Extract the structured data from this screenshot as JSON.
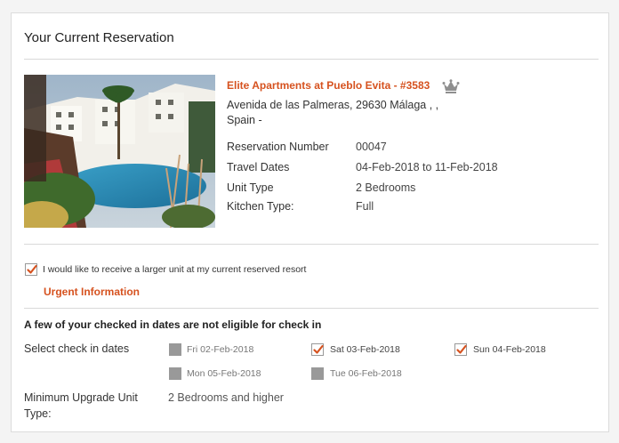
{
  "panel": {
    "title": "Your Current Reservation"
  },
  "resort": {
    "image_alt": "resort-photo",
    "name": "Elite Apartments at Pueblo Evita - #3583",
    "address_line1": "Avenida de las Palmeras, 29630 Málaga ,  ,",
    "address_line2": "Spain  -",
    "crown_icon": "crown-icon"
  },
  "details": [
    {
      "label": "Reservation Number",
      "value": "00047"
    },
    {
      "label": "Travel Dates",
      "value": "04-Feb-2018 to 11-Feb-2018"
    },
    {
      "label": "Unit Type",
      "value": "2 Bedrooms"
    },
    {
      "label": "Kitchen Type:",
      "value": "Full"
    }
  ],
  "upgrade": {
    "checked": true,
    "label": "I would like to receive a larger unit at my current reserved resort",
    "urgent_link": "Urgent Information"
  },
  "checkin": {
    "warning": "A few of your checked in dates are not eligible for check in",
    "select_label": "Select check in dates",
    "dates": [
      {
        "label": "Fri 02-Feb-2018",
        "state": "disabled"
      },
      {
        "label": "Sat 03-Feb-2018",
        "state": "checked"
      },
      {
        "label": "Sun 04-Feb-2018",
        "state": "checked"
      },
      {
        "label": "Mon 05-Feb-2018",
        "state": "disabled"
      },
      {
        "label": "Tue 06-Feb-2018",
        "state": "disabled"
      }
    ]
  },
  "minimum": {
    "label_line1": "Minimum Upgrade Unit",
    "label_line2": "Type:",
    "value": "2 Bedrooms and higher"
  },
  "colors": {
    "accent": "#d6521f",
    "divider": "#d9d9d9",
    "disabled": "#999999"
  }
}
